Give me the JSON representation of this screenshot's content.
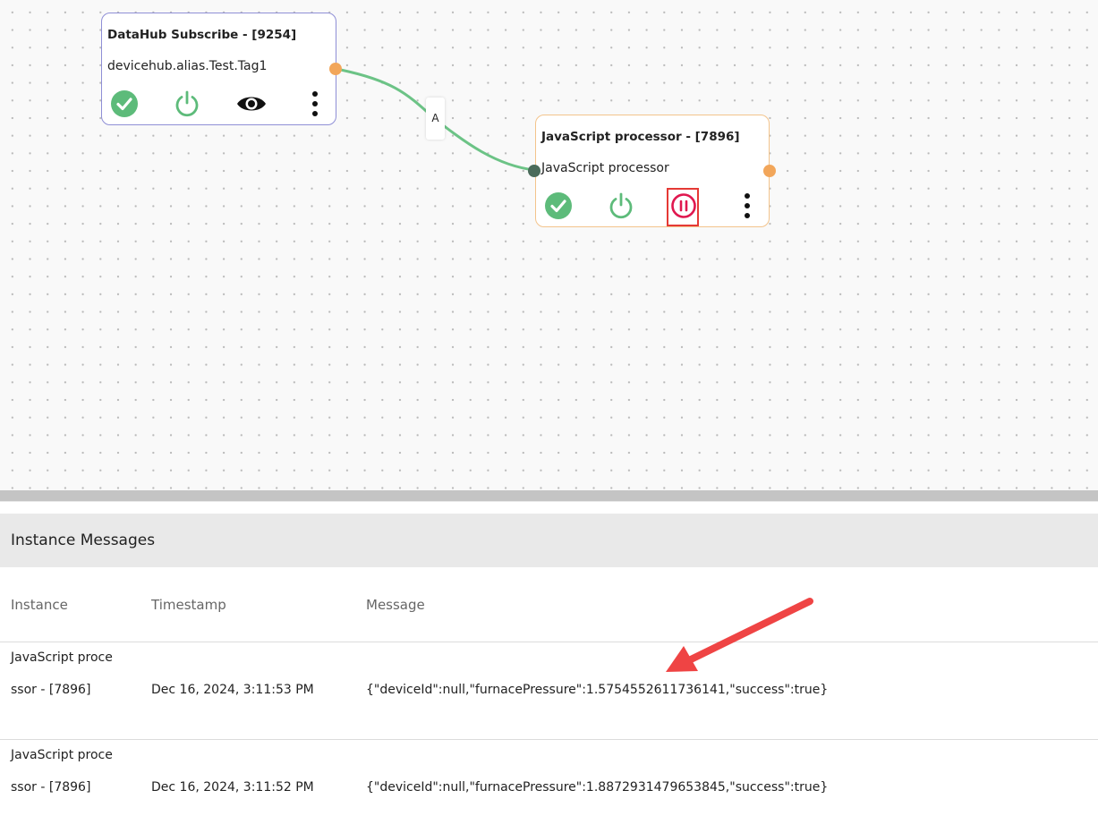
{
  "flow": {
    "nodes": [
      {
        "title": "DataHub Subscribe - [9254]",
        "subtitle": "devicehub.alias.Test.Tag1",
        "icons": [
          "check-circle-icon",
          "power-icon",
          "eye-icon",
          "more-vertical-icon"
        ]
      },
      {
        "title": "JavaScript processor - [7896]",
        "subtitle": "JavaScript processor",
        "icons": [
          "check-circle-icon",
          "power-icon",
          "pause-circle-icon",
          "more-vertical-icon"
        ]
      }
    ],
    "edge_label": "A",
    "colors": {
      "edge": "#6cc386",
      "check": "#5dbb7a",
      "power": "#5dbb7a",
      "pause": "#e0184f",
      "output_port": "#f2a65a",
      "highlight": "#e53935"
    }
  },
  "messages": {
    "title": "Instance Messages",
    "columns": {
      "instance": "Instance",
      "timestamp": "Timestamp",
      "message": "Message"
    },
    "rows": [
      {
        "instance": "JavaScript processor - [7896]",
        "timestamp": "Dec 16, 2024, 3:11:53 PM",
        "message": "{\"deviceId\":null,\"furnacePressure\":1.5754552611736141,\"success\":true}"
      },
      {
        "instance": "JavaScript processor - [7896]",
        "timestamp": "Dec 16, 2024, 3:11:52 PM",
        "message": "{\"deviceId\":null,\"furnacePressure\":1.8872931479653845,\"success\":true}"
      }
    ]
  }
}
